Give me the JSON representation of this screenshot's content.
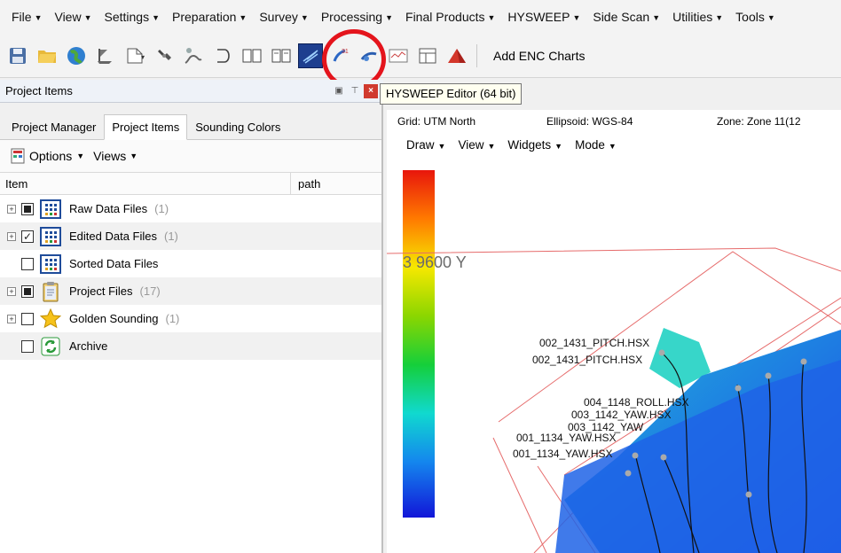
{
  "menubar": {
    "items": [
      {
        "label": "File"
      },
      {
        "label": "View"
      },
      {
        "label": "Settings"
      },
      {
        "label": "Preparation"
      },
      {
        "label": "Survey"
      },
      {
        "label": "Processing"
      },
      {
        "label": "Final Products"
      },
      {
        "label": "HYSWEEP"
      },
      {
        "label": "Side Scan"
      },
      {
        "label": "Utilities"
      },
      {
        "label": "Tools"
      }
    ]
  },
  "toolbar": {
    "add_enc_label": "Add ENC Charts",
    "tooltip": "HYSWEEP Editor (64 bit)"
  },
  "left_panel": {
    "title": "Project Items",
    "tabs": [
      "Project Manager",
      "Project Items",
      "Sounding Colors"
    ],
    "active_tab": "Project Items",
    "options_label": "Options",
    "views_label": "Views",
    "columns": {
      "item": "Item",
      "path": "path"
    },
    "tree": [
      {
        "label": "Raw Data Files",
        "count": "(1)",
        "icon": "grid-file-icon",
        "state": "partial",
        "expand": true
      },
      {
        "label": "Edited Data Files",
        "count": "(1)",
        "icon": "grid-file-icon",
        "state": "checked",
        "expand": true
      },
      {
        "label": "Sorted Data Files",
        "count": "",
        "icon": "grid-file-icon",
        "state": "none",
        "expand": false
      },
      {
        "label": "Project Files",
        "count": "(17)",
        "icon": "clipboard-icon",
        "state": "partial",
        "expand": true
      },
      {
        "label": "Golden Sounding",
        "count": "(1)",
        "icon": "star-icon",
        "state": "none",
        "expand": true
      },
      {
        "label": "Archive",
        "count": "",
        "icon": "recycle-icon",
        "state": "none",
        "expand": false
      }
    ]
  },
  "editor": {
    "grid": "Grid: UTM North",
    "ellipsoid": "Ellipsoid: WGS-84",
    "zone": "Zone: Zone 11(12",
    "menu": [
      "Draw",
      "View",
      "Widgets",
      "Mode"
    ],
    "coordinate_label": "3 9600 Y",
    "line_labels": [
      "002_1431_PITCH.HSX",
      "002_1431_PITCH.HSX",
      "004_1148_ROLL.HSX",
      "003_1142_YAW.HSX",
      "003_1142_YAW",
      "001_1134_YAW.HSX",
      "001_1134_YAW.HSX"
    ]
  },
  "colors": {
    "highlight_circle": "#e4141c",
    "scale_top": "#e8160c",
    "scale_bottom": "#1216d8",
    "boundary_lines": "#e66b6b"
  }
}
